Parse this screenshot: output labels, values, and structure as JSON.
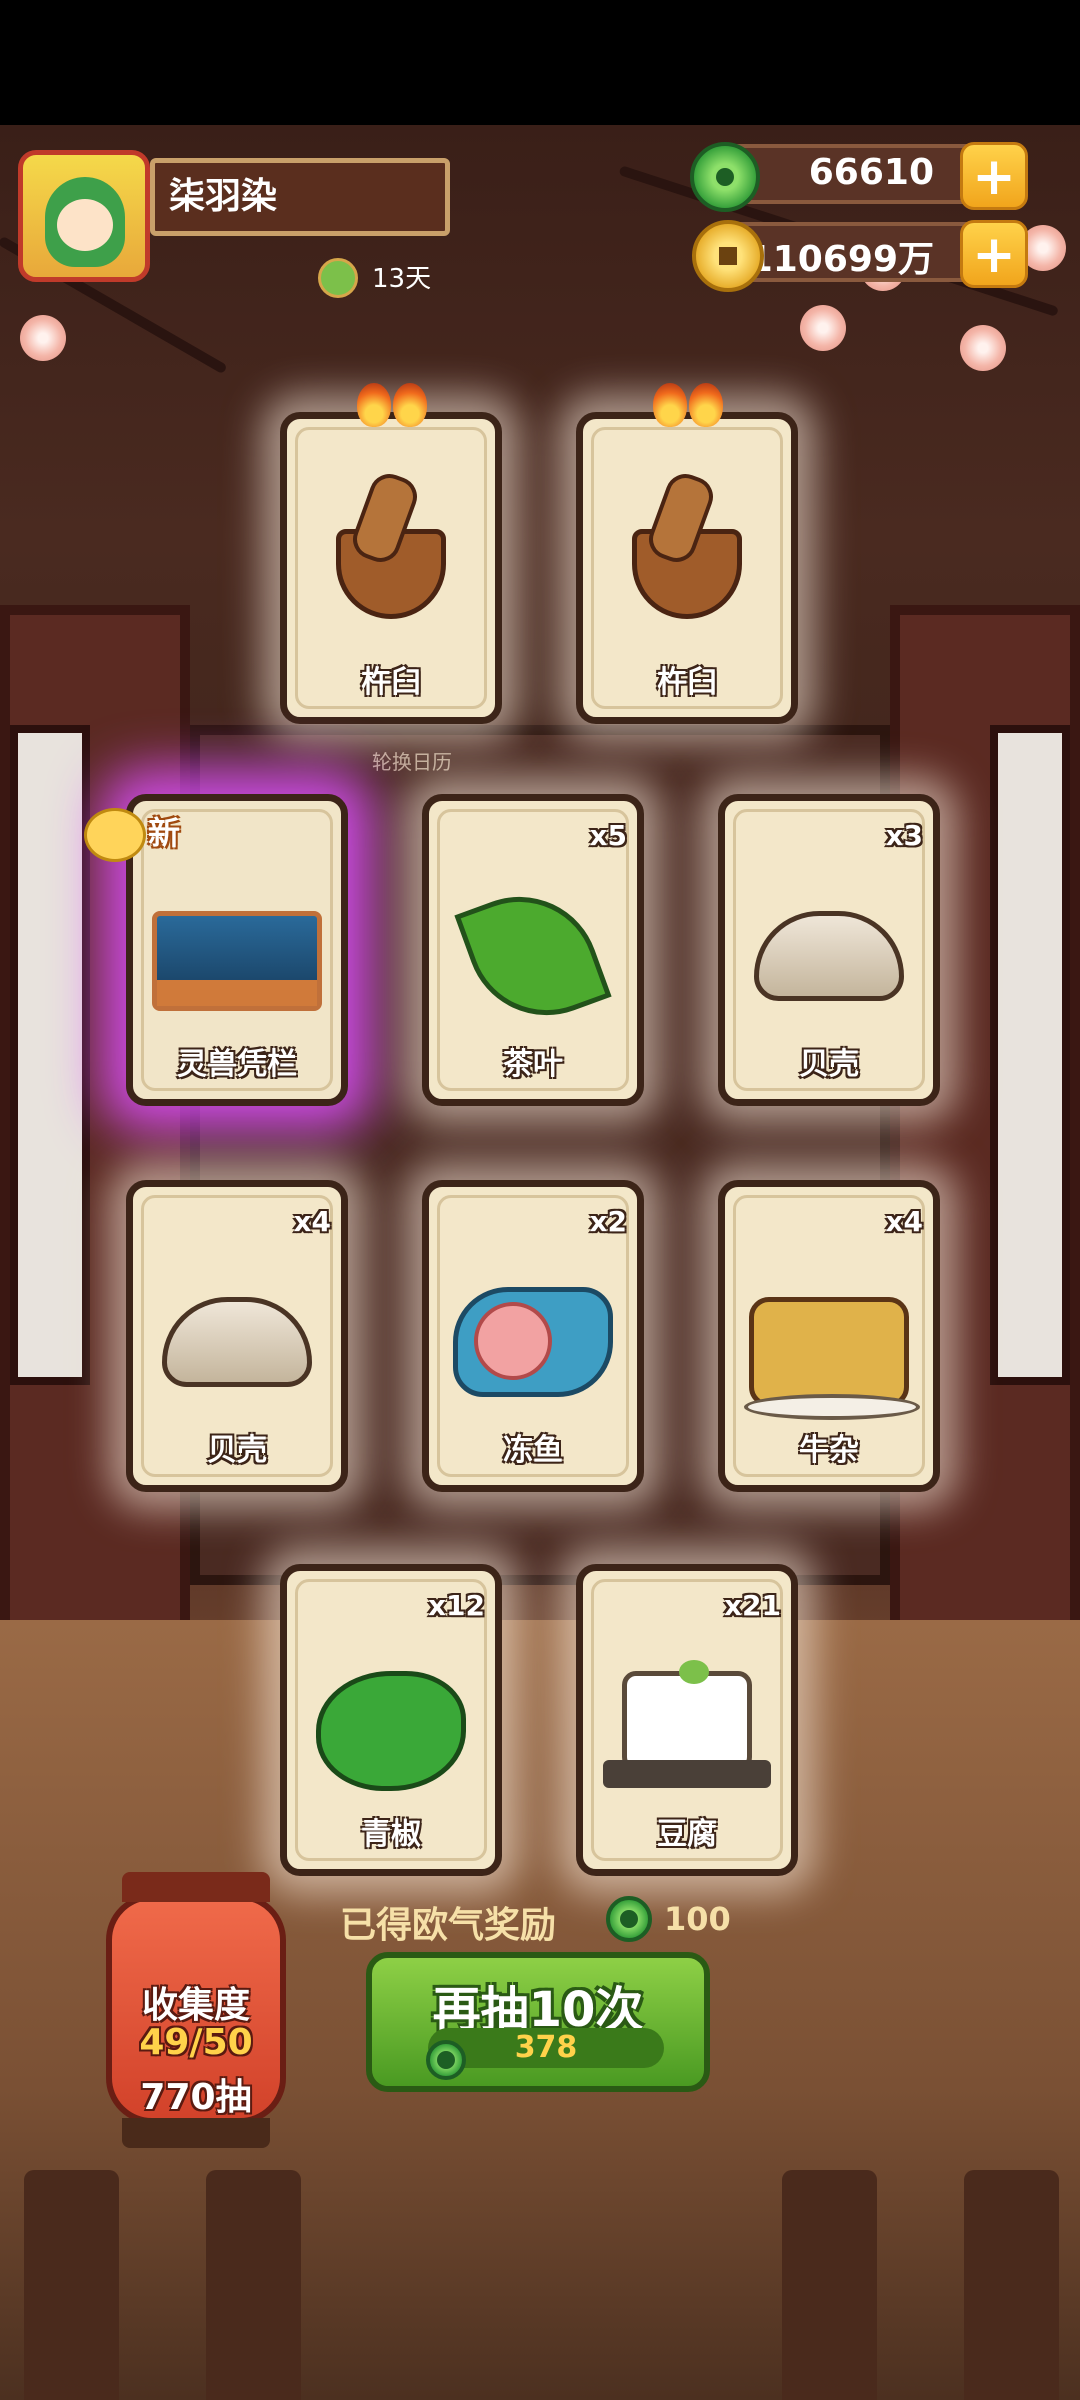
{
  "player": {
    "name": "柒羽染",
    "days": "13天"
  },
  "currency": {
    "jade": "66610",
    "gold": "110699万"
  },
  "sub_label": "轮换日历",
  "cards": [
    {
      "label": "杵臼",
      "count": "",
      "icon": "mortar-pestle-icon",
      "flames": true
    },
    {
      "label": "杵臼",
      "count": "",
      "icon": "mortar-pestle-icon",
      "flames": true
    },
    {
      "label": "灵兽凭栏",
      "count": "",
      "icon": "stage-railing-icon",
      "new": "新"
    },
    {
      "label": "茶叶",
      "count": "x5",
      "icon": "tea-leaf-icon"
    },
    {
      "label": "贝壳",
      "count": "x3",
      "icon": "shell-icon"
    },
    {
      "label": "贝壳",
      "count": "x4",
      "icon": "shell-icon"
    },
    {
      "label": "冻鱼",
      "count": "x2",
      "icon": "frozen-fish-icon"
    },
    {
      "label": "牛杂",
      "count": "x4",
      "icon": "beef-offal-icon"
    },
    {
      "label": "青椒",
      "count": "x12",
      "icon": "green-pepper-icon"
    },
    {
      "label": "豆腐",
      "count": "x21",
      "icon": "tofu-icon"
    }
  ],
  "reward": {
    "label": "已得欧气奖励",
    "value": "100"
  },
  "draw_button": {
    "label": "再抽10次",
    "cost": "378"
  },
  "collection": {
    "title": "收集度",
    "progress": "49/50",
    "draws": "770抽"
  },
  "colors": {
    "jade": "#2d9a36",
    "gold": "#e2a21a",
    "button_green": "#4a9a22",
    "highlight_purple": "#de50ff"
  }
}
